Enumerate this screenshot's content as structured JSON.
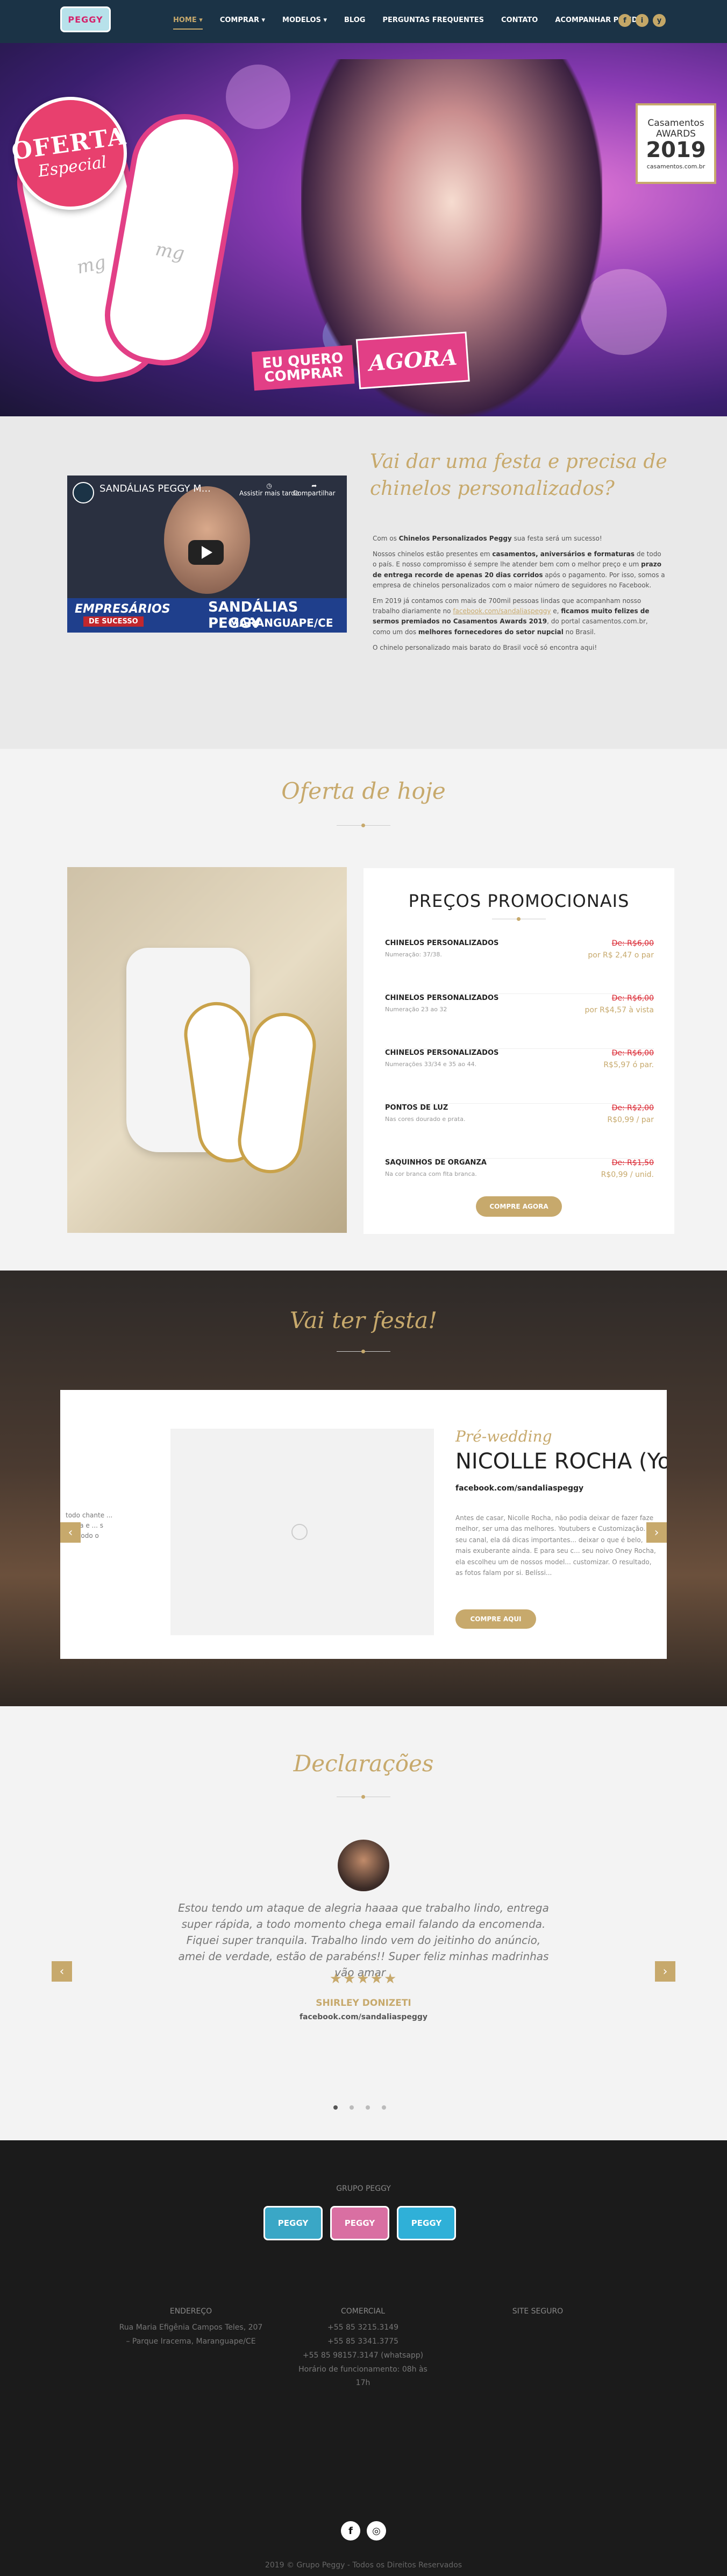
{
  "header": {
    "logo_text": "PEGGY",
    "nav": [
      {
        "label": "HOME",
        "dropdown": true,
        "active": true
      },
      {
        "label": "COMPRAR",
        "dropdown": true
      },
      {
        "label": "MODELOS",
        "dropdown": true
      },
      {
        "label": "BLOG"
      },
      {
        "label": "PERGUNTAS FREQUENTES"
      },
      {
        "label": "CONTATO"
      },
      {
        "label": "ACOMPANHAR PEDIDO"
      }
    ],
    "social": [
      "f",
      "i",
      "y"
    ]
  },
  "hero": {
    "badge_line1": "OFERTA",
    "badge_line2": "Especial",
    "cta_left_line1": "EU QUERO",
    "cta_left_line2": "COMPRAR",
    "cta_right": "AGORA",
    "award_line1": "Casamentos",
    "award_line2": "AWARDS",
    "award_year": "2019",
    "award_site": "casamentos.com.br",
    "monogram": "mg"
  },
  "intro": {
    "video": {
      "channel_title": "SANDÁLIAS PEGGY M...",
      "watch_later": "Assistir mais tarde",
      "share": "Compartilhar",
      "band_left": "EMPRESÁRIOS",
      "band_left_sub": "DE SUCESSO",
      "band_right": "SANDÁLIAS PEGGY",
      "band_right_sub": "MARANGUAPE/CE"
    },
    "title": "Vai dar uma festa e precisa de chinelos personalizados?",
    "p1_pre": "Com os ",
    "p1_bold": "Chinelos Personalizados Peggy",
    "p1_post": " sua festa será um sucesso!",
    "p2_a": "Nossos chinelos estão presentes em ",
    "p2_b": "casamentos, aniversários e formaturas",
    "p2_c": " de todo o país. E nosso compromisso é sempre lhe atender bem com o melhor preço e um ",
    "p2_d": "prazo de entrega recorde de apenas 20 dias corridos",
    "p2_e": " após o pagamento. Por isso, somos a empresa de chinelos personalizados com o maior número de seguidores no Facebook.",
    "p3_a": "Em 2019 já contamos com mais de 700mil pessoas lindas que acompanham nosso trabalho diariamente no ",
    "p3_link": "facebook.com/sandaliaspeggy",
    "p3_b": " e, ",
    "p3_c": "ficamos muito felizes de sermos premiados no Casamentos Awards 2019",
    "p3_d": ", do portal casamentos.com.br, como um dos ",
    "p3_e": "melhores fornecedores do setor nupcial",
    "p3_f": " no Brasil.",
    "p4": "O chinelo personalizado mais barato do Brasil você só encontra aqui!"
  },
  "offer": {
    "title": "Oferta de hoje",
    "card_title": "PREÇOS PROMOCIONAIS",
    "items": [
      {
        "name": "CHINELOS PERSONALIZADOS",
        "desc": "Numeração: 37/38.",
        "old": "De: R$6,00",
        "new": "por R$ 2,47 o par"
      },
      {
        "name": "CHINELOS PERSONALIZADOS",
        "desc": "Numeração 23 ao 32",
        "old": "De: R$6,00",
        "new": "por R$4,57 à vista"
      },
      {
        "name": "CHINELOS PERSONALIZADOS",
        "desc": "Numerações 33/34 e 35 ao 44.",
        "old": "De: R$6,00",
        "new": "R$5,97 ó par."
      },
      {
        "name": "PONTOS DE LUZ",
        "desc": "Nas cores dourado e prata.",
        "old": "De: R$2,00",
        "new": "R$0,99 / par"
      },
      {
        "name": "SAQUINHOS DE ORGANZA",
        "desc": "Na cor branca com fita branca.",
        "old": "De: R$1,50",
        "new": "R$0,99 / unid."
      }
    ],
    "button": "COMPRE AGORA"
  },
  "party": {
    "title": "Vai ter festa!",
    "prev_text": "todo chante ... ginha e ... s por todo o",
    "subtitle": "Pré-wedding",
    "name": "NICOLLE ROCHA (Youtuber)",
    "facebook": "facebook.com/sandaliaspeggy",
    "text": "Antes de casar, Nicolle Rocha, não podia deixar de fazer faze melhor, ser uma das melhores. Youtubers e Customização. Em seu canal, ela dá dicas importantes... deixar o que é belo, mais exuberante ainda. E para seu c... seu noivo Oney Rocha, ela escolheu um de nossos model... customizar. O resultado, as fotos falam por si. Belíssi...",
    "button": "COMPRE AQUI"
  },
  "testimonials": {
    "title": "Declarações",
    "quote": "Estou tendo um ataque de alegria haaaa que trabalho lindo, entrega super rápida, a todo momento chega email falando da encomenda. Fiquei super tranquila. Trabalho lindo vem do jeitinho do anúncio, amei de verdade, estão de parabéns!! Super feliz minhas madrinhas vão amar .",
    "stars": "★★★★★",
    "rating": 5,
    "name": "SHIRLEY DONIZETI",
    "facebook": "facebook.com/sandaliaspeggy"
  },
  "footer": {
    "group_label": "GRUPO PEGGY",
    "brands": [
      "PEGGY",
      "PEGGY",
      "PEGGY"
    ],
    "address_title": "ENDEREÇO",
    "address_line1": "Rua Maria Efigênia Campos Teles, 207",
    "address_line2": "– Parque Iracema, Maranguape/CE",
    "commercial_title": "COMERCIAL",
    "phone1": "+55 85 3215.3149",
    "phone2": "+55 85 3341.3775",
    "phone3": "+55 85 98157.3147 (whatsapp)",
    "hours": "Horário de funcionamento: 08h às 17h",
    "secure_title": "SITE SEGURO",
    "social": [
      "f",
      "◎"
    ],
    "copyright": "2019 © Grupo Peggy - Todos os Direitos Reservados"
  },
  "colors": {
    "gold": "#c7a96c",
    "navy": "#1b3346",
    "pink": "#e23f86",
    "red": "#d9242f"
  }
}
